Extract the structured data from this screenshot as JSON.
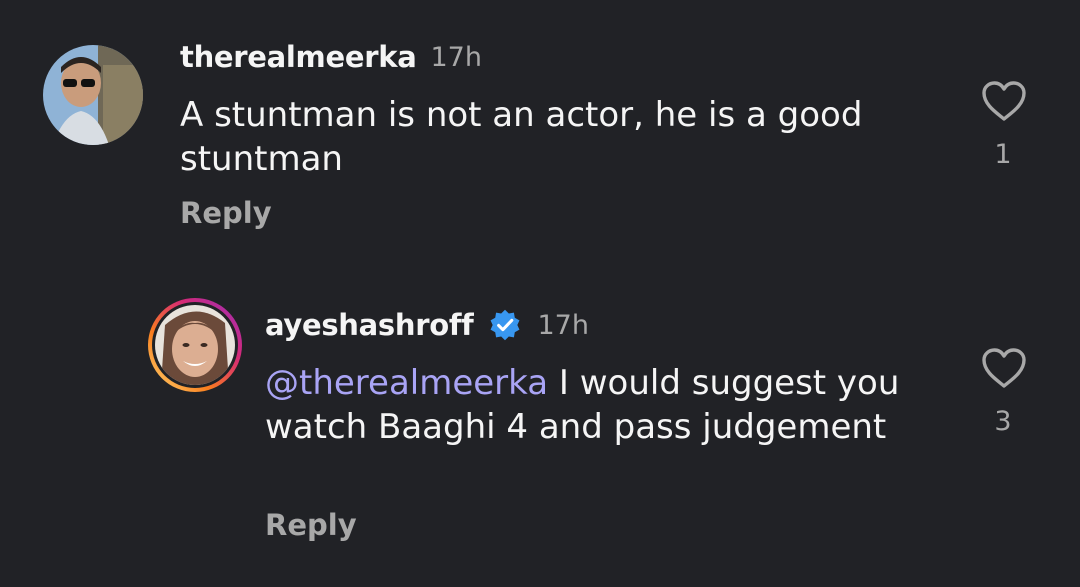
{
  "comments": [
    {
      "username": "therealmeerka",
      "time": "17h",
      "text": "A stuntman is not an actor, he is a good stuntman",
      "reply_label": "Reply",
      "like_count": "1"
    },
    {
      "username": "ayeshashroff",
      "time": "17h",
      "mention": "@therealmeerka",
      "text": " I would suggest you watch Baaghi 4 and pass judgement",
      "reply_label": "Reply",
      "like_count": "3",
      "verified": true
    }
  ],
  "colors": {
    "background": "#212226",
    "mention": "#a9a4f5",
    "verified_badge": "#3897f0",
    "muted": "#a8a8a8"
  }
}
